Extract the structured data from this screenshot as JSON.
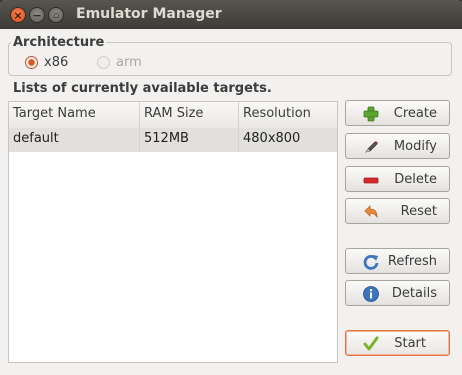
{
  "window": {
    "title": "Emulator Manager"
  },
  "architecture": {
    "label": "Architecture",
    "options": [
      {
        "label": "x86",
        "selected": true,
        "enabled": true
      },
      {
        "label": "arm",
        "selected": false,
        "enabled": false
      }
    ]
  },
  "targets": {
    "heading": "Lists of currently available targets.",
    "columns": [
      "Target Name",
      "RAM Size",
      "Resolution"
    ],
    "rows": [
      {
        "name": "default",
        "ram": "512MB",
        "resolution": "480x800"
      }
    ]
  },
  "buttons": {
    "create": "Create",
    "modify": "Modify",
    "delete": "Delete",
    "reset": "Reset",
    "refresh": "Refresh",
    "details": "Details",
    "start": "Start"
  },
  "colors": {
    "titlebar": "#3c3b37",
    "selection_row": "#e2e0dd",
    "accent_orange": "#e05420",
    "create_green": "#5ea431",
    "delete_red": "#d42a2a",
    "info_blue": "#3b74c1"
  }
}
